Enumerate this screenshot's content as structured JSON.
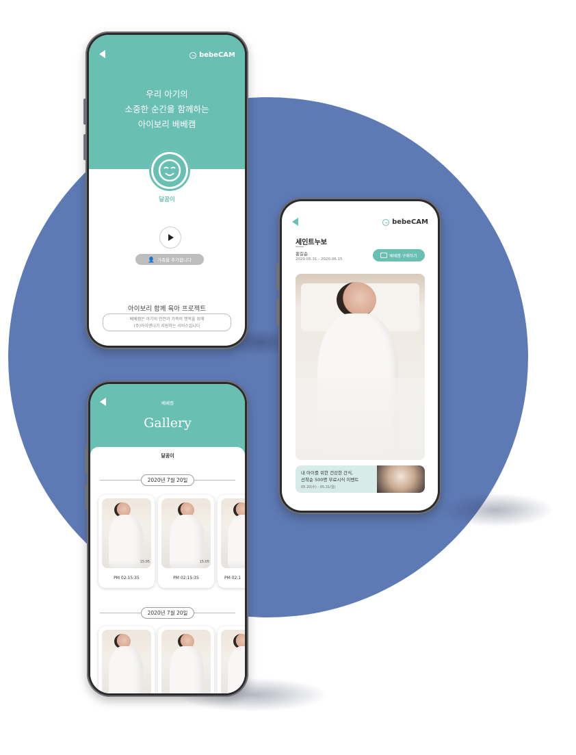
{
  "colors": {
    "accent": "#69bfb2",
    "backdrop": "#5e7ab5",
    "button_gray": "#bdbdbd"
  },
  "logo": {
    "text": "bebeCAM"
  },
  "screen_home": {
    "headline": [
      "우리 아기의",
      "소중한 순간을 함께하는",
      "아이보리 베베캠"
    ],
    "baby_name": "달꿈이",
    "add_family_label": "가족을 추가합니다",
    "project_title": "아이보리 함께 육아 프로젝트",
    "project_desc": [
      "베베캠은 아기의 안전과 가족의 행복을 위해",
      "(주)아이엔나가 지원하는 서비스입니다"
    ],
    "icons": {
      "back": "back-arrow-icon",
      "face": "smile-face-icon",
      "play": "play-icon",
      "add_user": "add-user-icon"
    }
  },
  "screen_detail": {
    "title": "세인트누보",
    "person": "홍길순",
    "period": "2020.05.31 - 2020.06.15",
    "buy_button": "베베캠 구매하기",
    "banner_line1": "내 아이를 위한 건강한 간식,",
    "banner_line2": "선착순 500명 무료시식 이벤트",
    "banner_date": "05.20(수) - 05.31(일)"
  },
  "screen_gallery": {
    "top_label": "베베캠",
    "title": "Gallery",
    "baby_name": "달꿈이",
    "sections": [
      {
        "date": "2020년 7월 20일",
        "items": [
          {
            "duration": "15:05",
            "time": "PM 02:15:35"
          },
          {
            "duration": "15:05",
            "time": "PM 02:15:35"
          },
          {
            "duration": "",
            "time": "PM 02:1"
          }
        ]
      },
      {
        "date": "2020년 7월 20일",
        "items": [
          {
            "duration": "",
            "time": ""
          },
          {
            "duration": "",
            "time": ""
          },
          {
            "duration": "",
            "time": ""
          }
        ]
      }
    ]
  }
}
